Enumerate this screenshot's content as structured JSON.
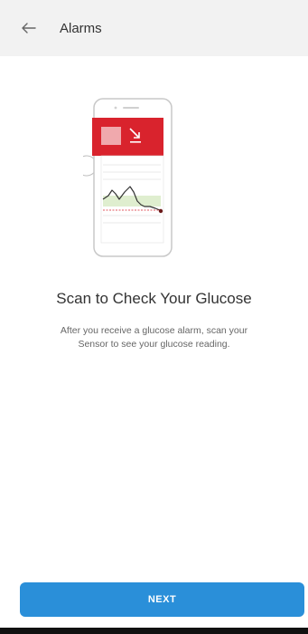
{
  "app_bar": {
    "back_icon": "arrow-left-icon",
    "title": "Alarms"
  },
  "illustration": {
    "description_icon": "phone-scan-illustration",
    "accent_color": "#d9232d"
  },
  "content": {
    "headline": "Scan to Check Your Glucose",
    "description": "After you receive a glucose alarm, scan your Sensor to see your glucose reading."
  },
  "footer": {
    "next_label": "NEXT",
    "button_color": "#2a8fd9"
  }
}
